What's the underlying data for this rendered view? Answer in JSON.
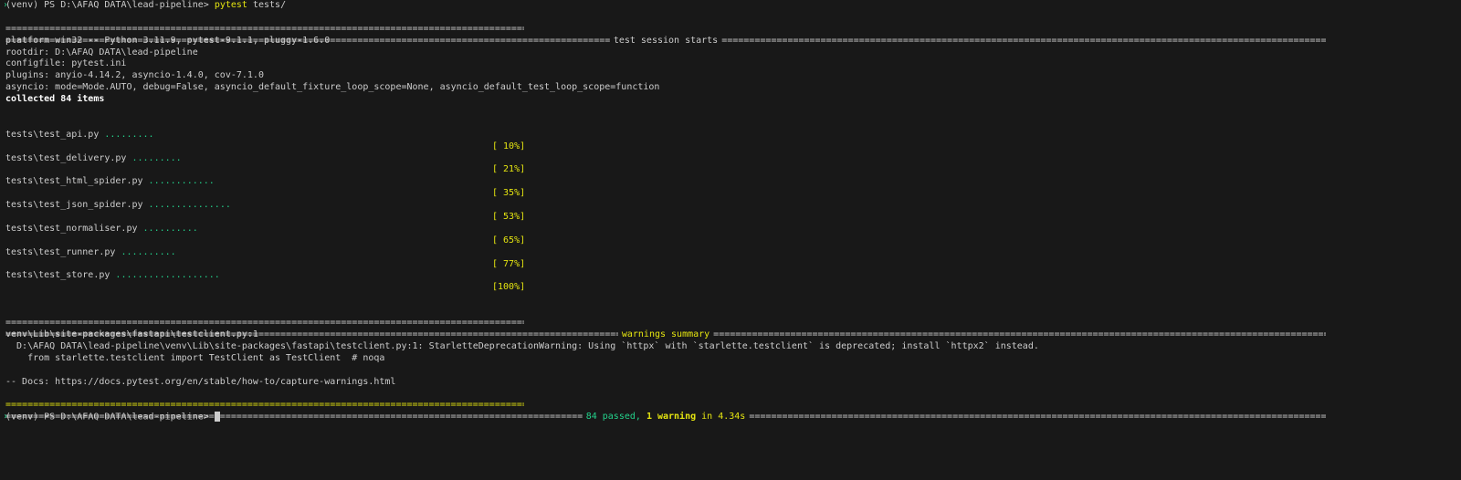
{
  "prompt": {
    "venv": "(venv)",
    "path": "PS D:\\AFAQ DATA\\lead-pipeline>",
    "command": "pytest",
    "args": "tests/"
  },
  "session_header": "test session starts",
  "info": [
    "platform win32 -- Python 3.11.9, pytest-9.1.1, pluggy-1.6.0",
    "rootdir: D:\\AFAQ DATA\\lead-pipeline",
    "configfile: pytest.ini",
    "plugins: anyio-4.14.2, asyncio-1.4.0, cov-7.1.0",
    "asyncio: mode=Mode.AUTO, debug=False, asyncio_default_fixture_loop_scope=None, asyncio_default_test_loop_scope=function"
  ],
  "collected": "collected 84 items",
  "tests": [
    {
      "file": "tests\\test_api.py",
      "dots": ".........",
      "pct": "[ 10%]"
    },
    {
      "file": "tests\\test_delivery.py",
      "dots": ".........",
      "pct": "[ 21%]"
    },
    {
      "file": "tests\\test_html_spider.py",
      "dots": "............",
      "pct": "[ 35%]"
    },
    {
      "file": "tests\\test_json_spider.py",
      "dots": "...............",
      "pct": "[ 53%]"
    },
    {
      "file": "tests\\test_normaliser.py",
      "dots": "..........",
      "pct": "[ 65%]"
    },
    {
      "file": "tests\\test_runner.py",
      "dots": "..........",
      "pct": "[ 77%]"
    },
    {
      "file": "tests\\test_store.py",
      "dots": "...................",
      "pct": "[100%]"
    }
  ],
  "warnings_header": "warnings summary",
  "warnings": [
    "venv\\Lib\\site-packages\\fastapi\\testclient.py:1",
    "  D:\\AFAQ DATA\\lead-pipeline\\venv\\Lib\\site-packages\\fastapi\\testclient.py:1: StarletteDeprecationWarning: Using `httpx` with `starlette.testclient` is deprecated; install `httpx2` instead.",
    "    from starlette.testclient import TestClient as TestClient  # noqa"
  ],
  "docs": "-- Docs: https://docs.pytest.org/en/stable/how-to/capture-warnings.html",
  "summary": {
    "passed": "84 passed",
    "sep": ", ",
    "warning": "1 warning",
    "time": " in 4.34s"
  },
  "prompt_end": {
    "venv": "(venv)",
    "path": "PS D:\\AFAQ DATA\\lead-pipeline>"
  },
  "colors": {
    "background": "#181818",
    "text": "#cccccc",
    "yellow": "#e5e510",
    "green": "#23d18b"
  }
}
